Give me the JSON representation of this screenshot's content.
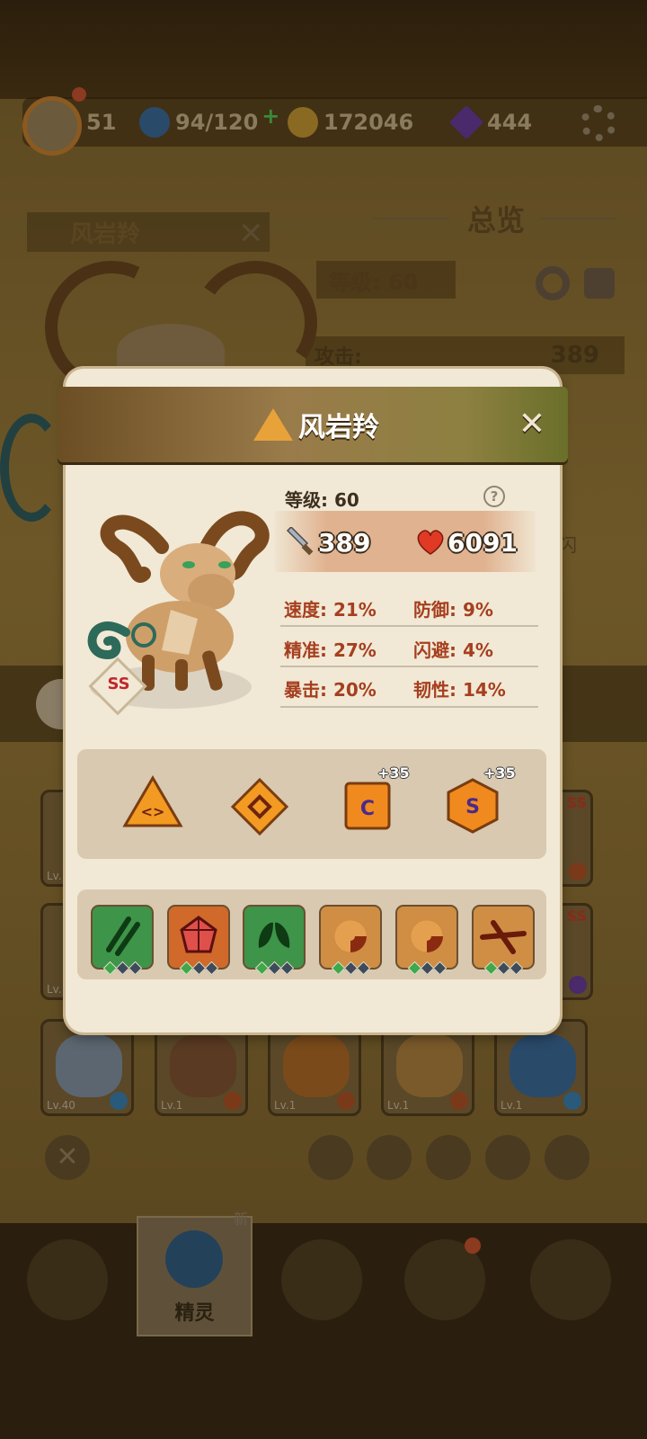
{
  "top_bar": {
    "player_level": "51",
    "energy": "94/120",
    "energy_add": "+",
    "coins": "172046",
    "gems": "444"
  },
  "background_panel": {
    "pet_name": "风岩羚",
    "overview_title": "总览",
    "level_label": "等级: 60",
    "attack_label": "攻击:",
    "attack_value": "389",
    "partial_text": "闪"
  },
  "pet_cards": [
    {
      "level": "Lv.40"
    },
    {
      "level": "Lv.1"
    },
    {
      "level": "Lv.1"
    },
    {
      "level": "Lv.1"
    },
    {
      "level": "Lv.1"
    }
  ],
  "pet_cards_side": {
    "left_lvl_1": "Lv.",
    "left_lvl_2": "Lv.",
    "ss": "SS"
  },
  "bottom_nav": {
    "selected_label": "精灵",
    "new_badge": "新"
  },
  "modal": {
    "title": "风岩羚",
    "level": "等级: 60",
    "help": "?",
    "attack": "389",
    "hp": "6091",
    "rarity": "SS",
    "stats": [
      {
        "label": "速度:",
        "value": "21%"
      },
      {
        "label": "防御:",
        "value": "9%"
      },
      {
        "label": "精准:",
        "value": "27%"
      },
      {
        "label": "闪避:",
        "value": "4%"
      },
      {
        "label": "暴击:",
        "value": "20%"
      },
      {
        "label": "韧性:",
        "value": "14%"
      }
    ],
    "runes": [
      {
        "icon": "triangle-rune-icon",
        "glyph": "<>",
        "bonus": ""
      },
      {
        "icon": "diamond-rune-icon",
        "glyph": "◇",
        "bonus": ""
      },
      {
        "icon": "square-rune-icon",
        "glyph": "C",
        "bonus": "+35"
      },
      {
        "icon": "hexagon-rune-icon",
        "glyph": "S",
        "bonus": "+35"
      }
    ],
    "skills": [
      {
        "icon": "claw-slash-skill-icon",
        "color": "#3b8f42",
        "dots": 1
      },
      {
        "icon": "crystal-skill-icon",
        "color": "#c8622a",
        "dots": 1
      },
      {
        "icon": "leaf-skill-icon",
        "color": "#3b8f42",
        "dots": 1
      },
      {
        "icon": "swirl-skill-icon",
        "color": "#c98a42",
        "dots": 1
      },
      {
        "icon": "swirl-skill-icon",
        "color": "#c98a42",
        "dots": 1
      },
      {
        "icon": "cross-slash-skill-icon",
        "color": "#c98a42",
        "dots": 1
      }
    ]
  },
  "colors": {
    "stat_text": "#a63f1f",
    "modal_bg": "#f1e9d6",
    "panel_bg": "#d8c9b0",
    "header_left": "#6b4e24",
    "header_right": "#6a6f2a"
  }
}
